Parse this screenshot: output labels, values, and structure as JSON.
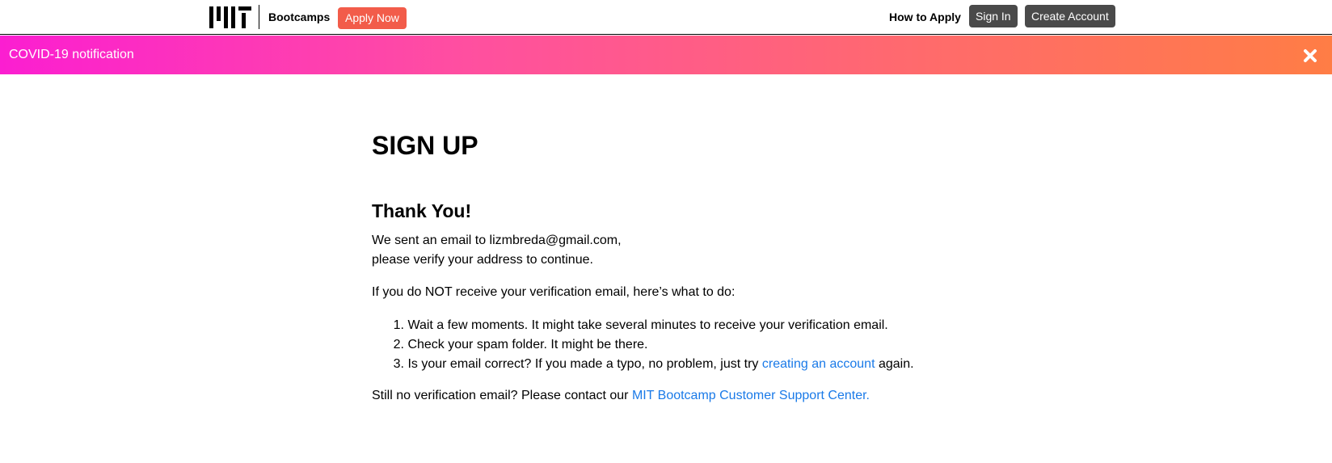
{
  "header": {
    "logo_text": "MIT",
    "brand": "Bootcamps",
    "apply_label": "Apply Now",
    "how_to_apply": "How to Apply",
    "sign_in": "Sign In",
    "create_account": "Create Account"
  },
  "banner": {
    "text": "COVID-19 notification",
    "close_icon": "close-icon"
  },
  "main": {
    "title": "SIGN UP",
    "heading": "Thank You!",
    "sent_line": "We sent an email to lizmbreda@gmail.com,",
    "verify_line": "please verify your address to continue.",
    "intro": "If you do NOT receive your verification email, here’s what to do:",
    "steps": [
      {
        "num": "1.",
        "text": "Wait a few moments. It might take several minutes to receive your verification email."
      },
      {
        "num": "2.",
        "text": "Check your spam folder. It might be there."
      },
      {
        "num": "3.",
        "text_before": "Is your email correct? If you made a typo, no problem, just try ",
        "link": "creating an account",
        "text_after": " again."
      }
    ],
    "support_before": "Still no verification email? Please contact our ",
    "support_link": "MIT Bootcamp Customer Support Center."
  },
  "colors": {
    "apply_button": "#f25c4a",
    "dark_button": "#4a4a4a",
    "link": "#1a7ae8",
    "banner_start": "#fb1ed1",
    "banner_end": "#ff7d45"
  }
}
